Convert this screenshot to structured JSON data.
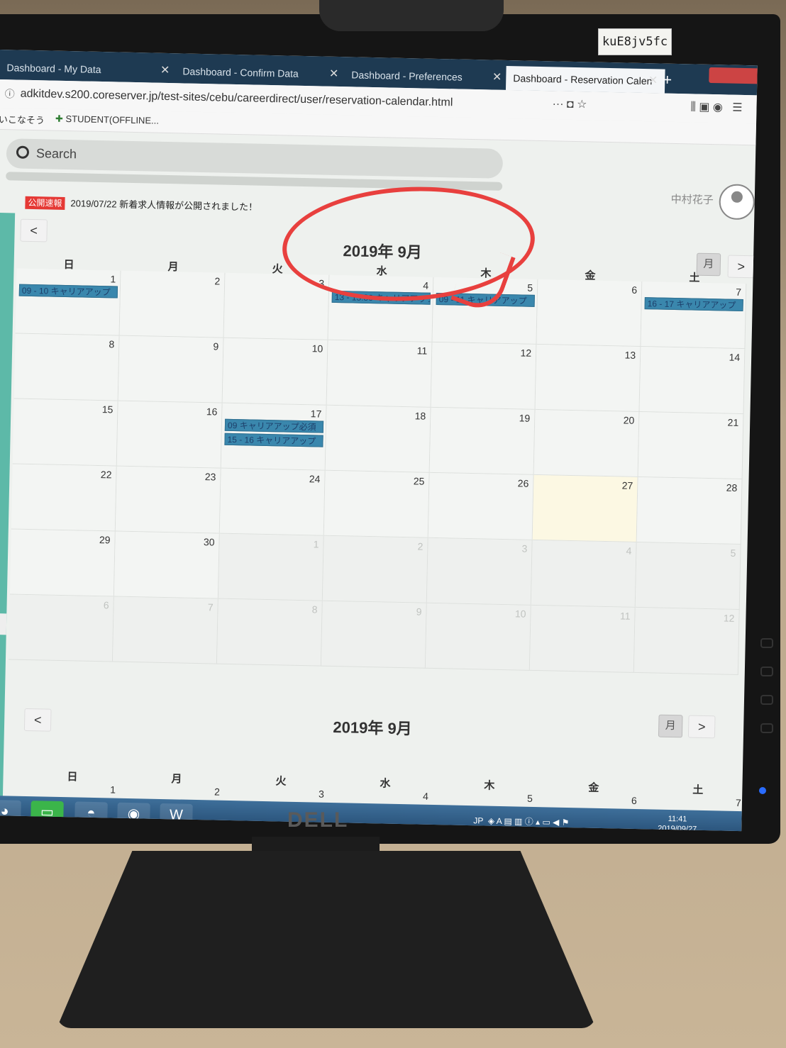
{
  "sticker": "kuE8jv5fc",
  "brand": "DELL",
  "browser": {
    "tabs": [
      {
        "label": "Dashboard - My Data"
      },
      {
        "label": "Dashboard - Confirm Data"
      },
      {
        "label": "Dashboard - Preferences"
      },
      {
        "label": "Dashboard - Reservation Calen",
        "active": true
      }
    ],
    "url": "adkitdev.s200.coreserver.jp/test-sites/cebu/careerdirect/user/reservation-calendar.html",
    "bookmarks": [
      "いこなそう",
      "STUDENT(OFFLINE..."
    ]
  },
  "page": {
    "search_label": "Search",
    "user_name": "中村花子",
    "notice_badge": "公開速報",
    "notice_text": "2019/07/22 新着求人情報が公開されました！"
  },
  "calendar": {
    "title": "2019年 9月",
    "view_button": "月",
    "prev_icon": "<",
    "next_icon": ">",
    "weekdays": [
      "日",
      "月",
      "火",
      "水",
      "木",
      "金",
      "土"
    ],
    "weeks": [
      [
        {
          "d": "1",
          "e": [
            "09 - 10 キャリアアップ"
          ]
        },
        {
          "d": "2"
        },
        {
          "d": "3"
        },
        {
          "d": "4",
          "e": [
            "13 - 13:30 キャリアアップ"
          ]
        },
        {
          "d": "5",
          "e": [
            "09 - 11 キャリアアップ"
          ]
        },
        {
          "d": "6"
        },
        {
          "d": "7",
          "e": [
            "16 - 17 キャリアアップ"
          ]
        }
      ],
      [
        {
          "d": "8"
        },
        {
          "d": "9"
        },
        {
          "d": "10"
        },
        {
          "d": "11"
        },
        {
          "d": "12"
        },
        {
          "d": "13"
        },
        {
          "d": "14"
        }
      ],
      [
        {
          "d": "15"
        },
        {
          "d": "16"
        },
        {
          "d": "17",
          "e": [
            "09 キャリアアップ必須",
            "15 - 16 キャリアアップ"
          ]
        },
        {
          "d": "18"
        },
        {
          "d": "19"
        },
        {
          "d": "20"
        },
        {
          "d": "21"
        }
      ],
      [
        {
          "d": "22"
        },
        {
          "d": "23"
        },
        {
          "d": "24"
        },
        {
          "d": "25"
        },
        {
          "d": "26"
        },
        {
          "d": "27",
          "today": true
        },
        {
          "d": "28"
        }
      ],
      [
        {
          "d": "29"
        },
        {
          "d": "30"
        },
        {
          "d": "1",
          "other": true
        },
        {
          "d": "2",
          "other": true
        },
        {
          "d": "3",
          "other": true
        },
        {
          "d": "4",
          "other": true
        },
        {
          "d": "5",
          "other": true
        }
      ],
      [
        {
          "d": "6",
          "other": true
        },
        {
          "d": "7",
          "other": true
        },
        {
          "d": "8",
          "other": true
        },
        {
          "d": "9",
          "other": true
        },
        {
          "d": "10",
          "other": true
        },
        {
          "d": "11",
          "other": true
        },
        {
          "d": "12",
          "other": true
        }
      ]
    ],
    "second_first_row": [
      "1",
      "2",
      "3",
      "4",
      "5",
      "6",
      "7"
    ]
  },
  "taskbar": {
    "apps": [
      "chrome-icon",
      "line-icon",
      "app-icon",
      "firefox-icon",
      "word-icon"
    ],
    "lang": "JP",
    "time": "11:41",
    "date": "2019/09/27"
  },
  "colors": {
    "event": "#3a87ad",
    "today": "#fcf8e3",
    "sidebar": "#5db9a8",
    "annotation": "#e8403e"
  }
}
